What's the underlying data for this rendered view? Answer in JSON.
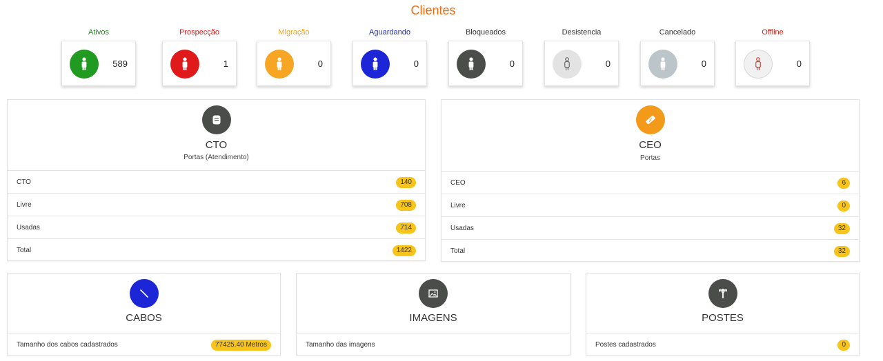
{
  "page": {
    "title": "Clientes"
  },
  "status_cards": [
    {
      "label": "Ativos",
      "count": "589",
      "label_color": "#1a8a1a",
      "circle_color": "#219a21",
      "icon": "person-icon"
    },
    {
      "label": "Prospecção",
      "count": "1",
      "label_color": "#d61a1a",
      "circle_color": "#e01a1a",
      "icon": "person-icon"
    },
    {
      "label": "Migração",
      "count": "0",
      "label_color": "#f5a623",
      "circle_color": "#f6a623",
      "icon": "person-icon"
    },
    {
      "label": "Aguardando",
      "count": "0",
      "label_color": "#1a2ec4",
      "circle_color": "#1d26d6",
      "icon": "person-icon"
    },
    {
      "label": "Bloqueados",
      "count": "0",
      "label_color": "#333333",
      "circle_color": "#4b4d4b",
      "icon": "person-icon"
    },
    {
      "label": "Desistencia",
      "count": "0",
      "label_color": "#333333",
      "circle_color": "#e3e3e3",
      "icon": "person-outline-icon"
    },
    {
      "label": "Cancelado",
      "count": "0",
      "label_color": "#333333",
      "circle_color": "#bcc5c9",
      "icon": "person-icon"
    },
    {
      "label": "Offline",
      "count": "0",
      "label_color": "#c8261a",
      "circle_color": "#f1f1f1",
      "icon": "person-outline-icon"
    }
  ],
  "cto": {
    "title": "CTO",
    "subtitle": "Portas (Atendimento)",
    "icon_color": "#4b4d4b",
    "rows": [
      {
        "label": "CTO",
        "value": "140"
      },
      {
        "label": "Livre",
        "value": "708"
      },
      {
        "label": "Usadas",
        "value": "714"
      },
      {
        "label": "Total",
        "value": "1422"
      }
    ]
  },
  "ceo": {
    "title": "CEO",
    "subtitle": "Portas",
    "icon_color": "#f39a1a",
    "rows": [
      {
        "label": "CEO",
        "value": "6"
      },
      {
        "label": "Livre",
        "value": "0"
      },
      {
        "label": "Usadas",
        "value": "32"
      },
      {
        "label": "Total",
        "value": "32"
      }
    ]
  },
  "cabos": {
    "title": "CABOS",
    "icon_color": "#1d26d6",
    "row_label": "Tamanho dos cabos cadastrados",
    "value": "77425.40 Metros"
  },
  "imagens": {
    "title": "IMAGENS",
    "icon_color": "#4b4d4b",
    "row_label": "Tamanho das imagens"
  },
  "postes": {
    "title": "POSTES",
    "icon_color": "#4b4d4b",
    "row_label": "Postes cadastrados",
    "value": "0"
  }
}
